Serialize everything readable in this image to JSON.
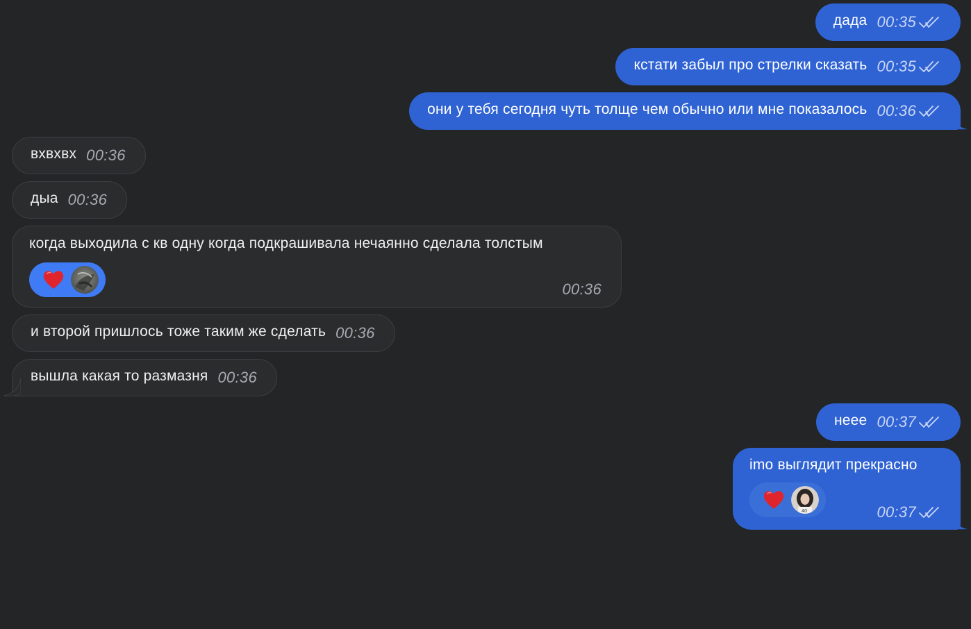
{
  "colors": {
    "background": "#232527",
    "outgoing_bubble": "#2f63d3",
    "incoming_bubble": "#2b2c2e",
    "reaction_active": "#3f7bf4",
    "heart": "#e0242c"
  },
  "icons": {
    "read_status": "double-check-icon",
    "reaction": "red-heart-emoji",
    "reactor": "avatar"
  },
  "messages": [
    {
      "direction": "outgoing",
      "text": "дада",
      "time": "00:35",
      "read": true
    },
    {
      "direction": "outgoing",
      "text": "кстати забыл про стрелки сказать",
      "time": "00:35",
      "read": true
    },
    {
      "direction": "outgoing",
      "text": "они у тебя сегодня чуть толще чем обычно или мне показалось",
      "time": "00:36",
      "read": true
    },
    {
      "direction": "incoming",
      "text": "вхвхвх",
      "time": "00:36"
    },
    {
      "direction": "incoming",
      "text": "дыа",
      "time": "00:36"
    },
    {
      "direction": "incoming",
      "text": "когда выходила с кв одну когда подкрашивала нечаянно сделала толстым",
      "time": "00:36",
      "reaction": "heart"
    },
    {
      "direction": "incoming",
      "text": "и второй пришлось тоже таким же сделать",
      "time": "00:36"
    },
    {
      "direction": "incoming",
      "text": "вышла какая то размазня",
      "time": "00:36"
    },
    {
      "direction": "outgoing",
      "text": "неее",
      "time": "00:37",
      "read": true
    },
    {
      "direction": "outgoing",
      "text": "imo выглядит прекрасно",
      "time": "00:37",
      "read": true,
      "reaction": "heart"
    }
  ]
}
